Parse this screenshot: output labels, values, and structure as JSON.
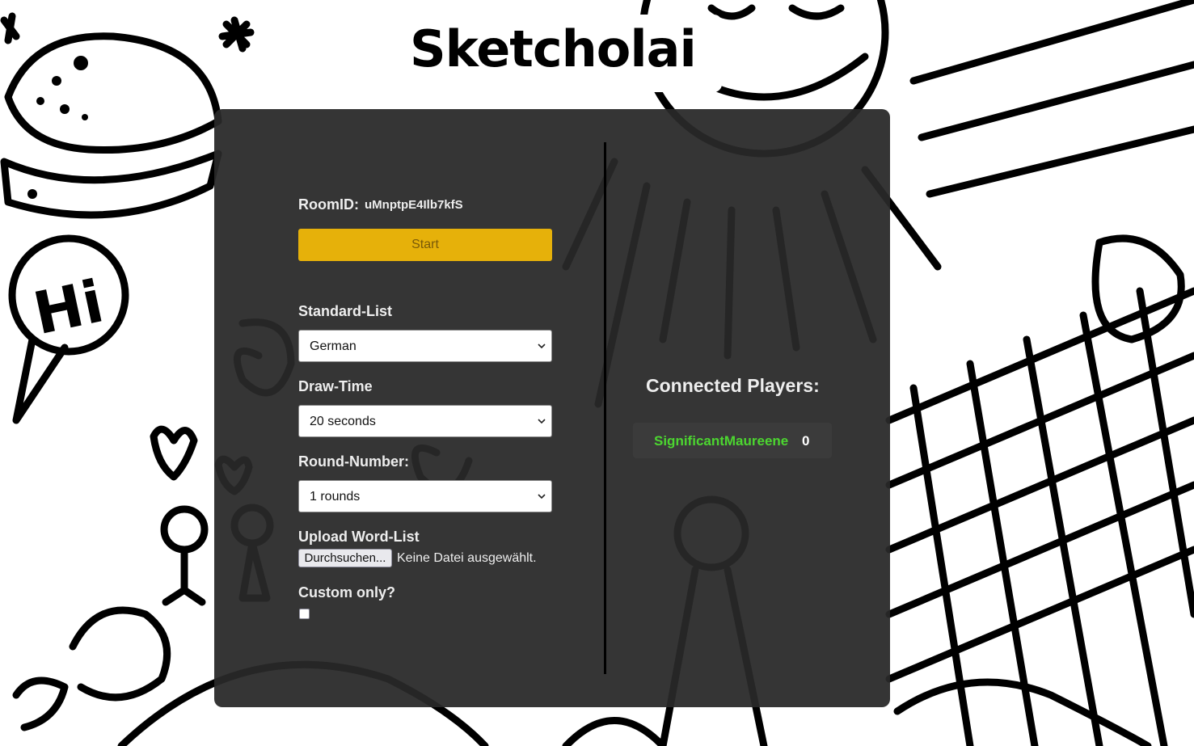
{
  "app": {
    "title": "Sketcholai"
  },
  "lobby": {
    "room_id_label": "RoomID:",
    "room_id_value": "uMnptpE4Ilb7kfS",
    "start_label": "Start",
    "standard_list_label": "Standard-List",
    "standard_list_value": "German",
    "draw_time_label": "Draw-Time",
    "draw_time_value": "20 seconds",
    "round_number_label": "Round-Number:",
    "round_number_value": "1 rounds",
    "upload_label": "Upload Word-List",
    "browse_label": "Durchsuchen...",
    "no_file_text": "Keine Datei ausgewählt.",
    "custom_only_label": "Custom only?",
    "custom_only_checked": false
  },
  "players": {
    "title": "Connected Players:",
    "list": [
      {
        "name": "SignificantMaureene",
        "score": "0"
      }
    ]
  },
  "colors": {
    "panel": "#282828",
    "accent_button": "#e6b10a",
    "player_name": "#4cd630",
    "label_text": "#eeeeee"
  }
}
